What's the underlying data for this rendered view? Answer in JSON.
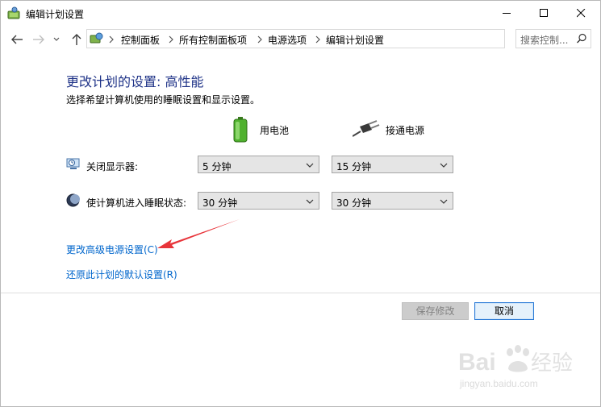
{
  "window": {
    "title": "编辑计划设置",
    "controls": {
      "minimize": "minimize-icon",
      "maximize": "maximize-icon",
      "close": "close-icon"
    }
  },
  "address": {
    "breadcrumbs": [
      "控制面板",
      "所有控制面板项",
      "电源选项",
      "编辑计划设置"
    ],
    "search_placeholder": "搜索控制..."
  },
  "main": {
    "heading": "更改计划的设置: 高性能",
    "description": "选择希望计算机使用的睡眠设置和显示设置。",
    "columns": {
      "battery": "用电池",
      "plugged": "接通电源"
    },
    "rows": [
      {
        "label": "关闭显示器:",
        "battery_value": "5 分钟",
        "plugged_value": "15 分钟"
      },
      {
        "label": "使计算机进入睡眠状态:",
        "battery_value": "30 分钟",
        "plugged_value": "30 分钟"
      }
    ],
    "links": {
      "advanced": "更改高级电源设置(C)",
      "restore": "还原此计划的默认设置(R)"
    }
  },
  "footer": {
    "save": "保存修改",
    "cancel": "取消"
  },
  "watermark": {
    "brand": "Baidu经验",
    "url": "jingyan.baidu.com"
  },
  "colors": {
    "heading": "#1e3287",
    "link": "#0066cc",
    "annotation_arrow": "#e8343a"
  }
}
